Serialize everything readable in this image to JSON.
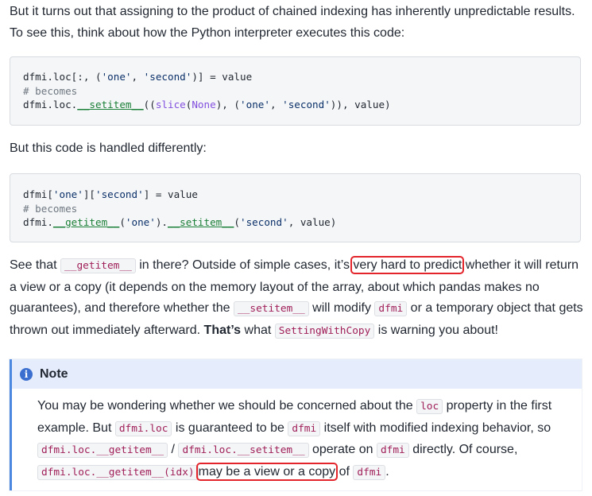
{
  "para1": {
    "text": "But it turns out that assigning to the product of chained indexing has inherently unpredictable results. To see this, think about how the Python interpreter executes this code:"
  },
  "code1": {
    "line1": {
      "a": "dfmi.loc[:, (",
      "s1": "'one'",
      "b": ", ",
      "s2": "'second'",
      "c": ")] = value"
    },
    "line2": "# becomes",
    "line3": {
      "a": "dfmi.loc.",
      "m": "__setitem__",
      "b": "((",
      "f": "slice",
      "c": "(",
      "n": "None",
      "d": "), (",
      "s1": "'one'",
      "e": ", ",
      "s2": "'second'",
      "g": ")), value)"
    }
  },
  "para2": {
    "text": "But this code is handled differently:"
  },
  "code2": {
    "line1": {
      "a": "dfmi[",
      "s1": "'one'",
      "b": "][",
      "s2": "'second'",
      "c": "] = value"
    },
    "line2": "# becomes",
    "line3": {
      "a": "dfmi.",
      "m1": "__getitem__",
      "b": "(",
      "s1": "'one'",
      "c": ").",
      "m2": "__setitem__",
      "d": "(",
      "s2": "'second'",
      "e": ", value)"
    }
  },
  "para3": {
    "t1": "See that ",
    "c1": "__getitem__",
    "t2": " in there? Outside of simple cases, it’s ",
    "hl": "very hard to predict",
    "t3": " whether it will return a view or a copy (it depends on the memory layout of the array, about which pandas makes no guarantees), and therefore whether the ",
    "c2": "__setitem__",
    "t4": " will modify ",
    "c3": "dfmi",
    "t5": " or a temporary object that gets thrown out immediately afterward. ",
    "bold": "That’s",
    "t6": " what ",
    "c4": "SettingWithCopy",
    "t7": " is warning you about!"
  },
  "note": {
    "icon": "info-icon",
    "title": "Note",
    "t1": "You may be wondering whether we should be concerned about the ",
    "c1": "loc",
    "t2": " property in the first example. But ",
    "c2": "dfmi.loc",
    "t3": " is guaranteed to be ",
    "c3": "dfmi",
    "t4": " itself with modified indexing behavior, so ",
    "c4": "dfmi.loc.__getitem__",
    "t5": " / ",
    "c5": "dfmi.loc.__setitem__",
    "t6": " operate on ",
    "c6": "dfmi",
    "t7": " directly. Of course, ",
    "c7": "dfmi.loc.__getitem__(idx)",
    "hl": "may be a view or a copy",
    "t8": " of ",
    "c8": "dfmi",
    "t9": "."
  },
  "colors": {
    "highlight_box": "#e3242b",
    "note_accent": "#4c87e0",
    "note_header_bg": "#e5ecfb",
    "inline_code": "#a0205a"
  }
}
